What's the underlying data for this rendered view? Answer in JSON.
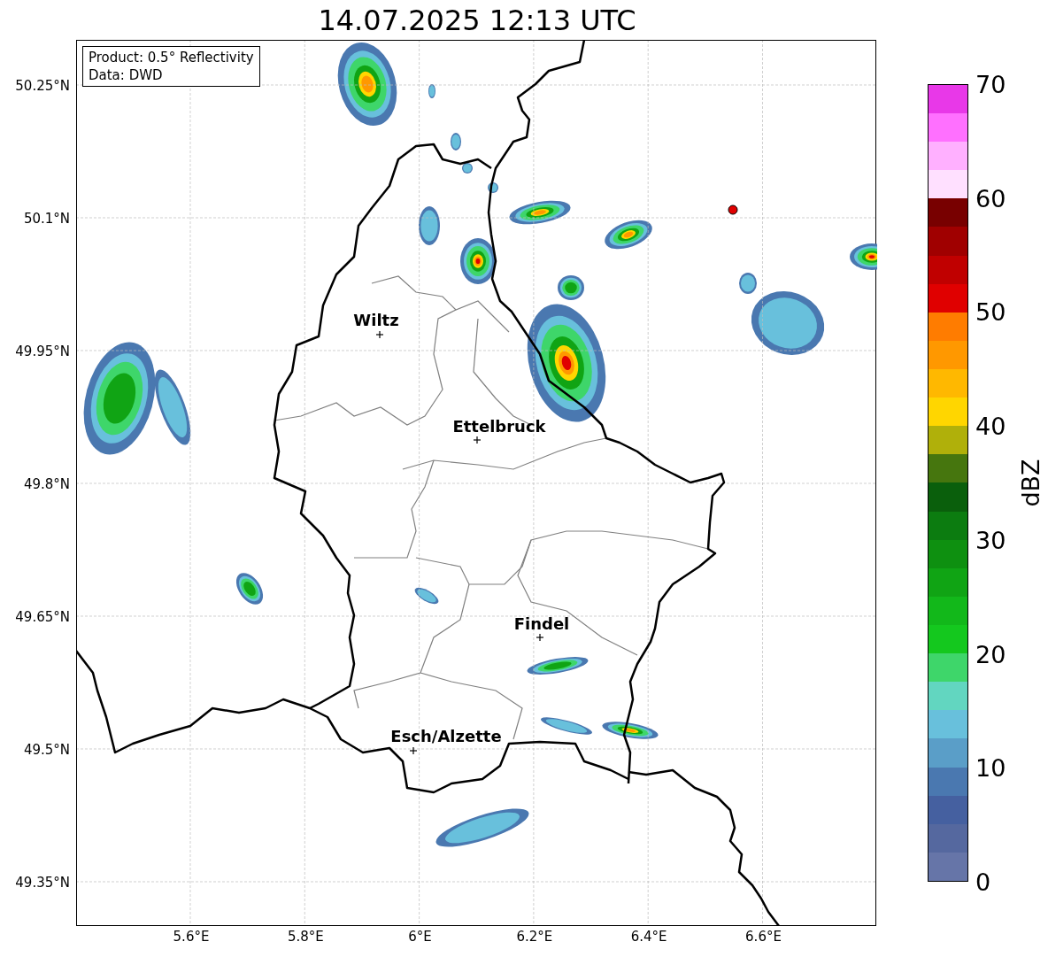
{
  "title": "14.07.2025 12:13 UTC",
  "info": [
    "Product: 0.5° Reflectivity",
    "Data: DWD"
  ],
  "lat_ticks": [
    "50.25°N",
    "50.1°N",
    "49.95°N",
    "49.8°N",
    "49.65°N",
    "49.5°N",
    "49.35°N"
  ],
  "lon_ticks": [
    "5.6°E",
    "5.8°E",
    "6°E",
    "6.2°E",
    "6.4°E",
    "6.6°E"
  ],
  "places": [
    {
      "name": "Wiltz"
    },
    {
      "name": "Ettelbruck"
    },
    {
      "name": "Findel"
    },
    {
      "name": "Esch/Alzette"
    }
  ],
  "colorbar": {
    "label": "dBZ",
    "ticks": [
      "70",
      "60",
      "50",
      "40",
      "30",
      "20",
      "10",
      "0"
    ],
    "bins": [
      {
        "color": "#6675a8"
      },
      {
        "color": "#55689f"
      },
      {
        "color": "#4560a0"
      },
      {
        "color": "#4a78b0"
      },
      {
        "color": "#5a9ec8"
      },
      {
        "color": "#68c0dc"
      },
      {
        "color": "#62d6c0"
      },
      {
        "color": "#3ed66a"
      },
      {
        "color": "#14c81e"
      },
      {
        "color": "#12b81a"
      },
      {
        "color": "#10a414"
      },
      {
        "color": "#0e9010"
      },
      {
        "color": "#0c7c10"
      },
      {
        "color": "#0a5f0c"
      },
      {
        "color": "#46760e"
      },
      {
        "color": "#b0b00a"
      },
      {
        "color": "#ffd600"
      },
      {
        "color": "#ffb800"
      },
      {
        "color": "#ff9800"
      },
      {
        "color": "#ff7c00"
      },
      {
        "color": "#e00000"
      },
      {
        "color": "#c00000"
      },
      {
        "color": "#a00000"
      },
      {
        "color": "#780000"
      },
      {
        "color": "#ffe0ff"
      },
      {
        "color": "#ffb0ff"
      },
      {
        "color": "#ff70ff"
      },
      {
        "color": "#e838e8"
      }
    ]
  }
}
